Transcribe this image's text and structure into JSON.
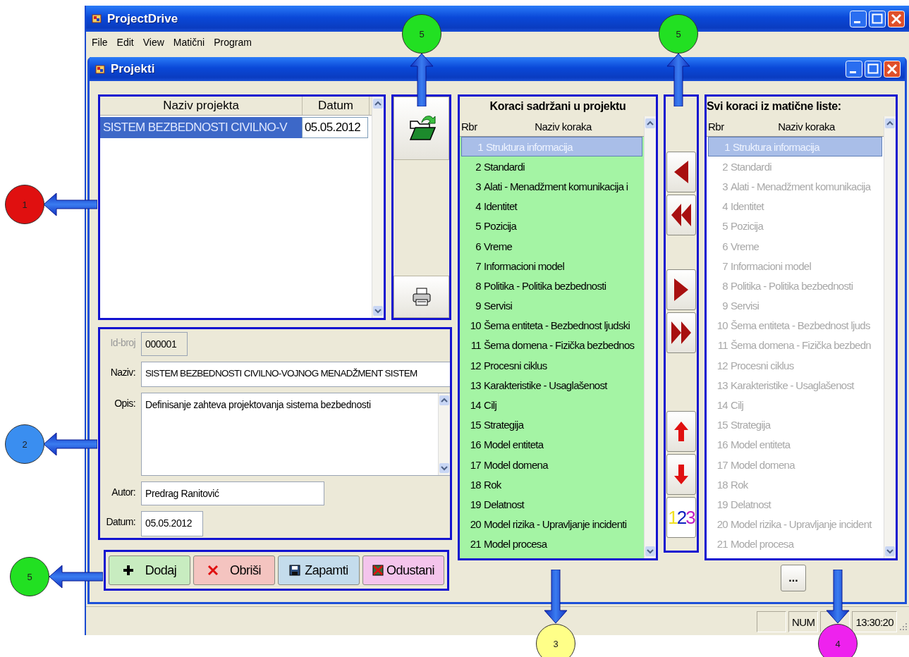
{
  "app": {
    "title": "ProjectDrive",
    "menu": [
      "File",
      "Edit",
      "View",
      "Matični",
      "Program"
    ]
  },
  "child": {
    "title": "Projekti"
  },
  "projects": {
    "columns": [
      "Naziv projekta",
      "Datum"
    ],
    "rows": [
      {
        "name": "SISTEM BEZBEDNOSTI CIVILNO-V",
        "date": "05.05.2012",
        "selected": true
      }
    ]
  },
  "form": {
    "fields": [
      {
        "label": "Id-broj",
        "value": "000001",
        "kind": "readonly"
      },
      {
        "label": "Naziv:",
        "value": "SISTEM BEZBEDNOSTI CIVILNO-VOJNOG MENADŽMENT SISTEM",
        "kind": "wide"
      },
      {
        "label": "Opis:",
        "value": "Definisanje zahteva projektovanja sistema bezbednosti",
        "kind": "memo"
      },
      {
        "label": "Autor:",
        "value": "Predrag Ranitović",
        "kind": "medium"
      },
      {
        "label": "Datum:",
        "value": "05.05.2012",
        "kind": "date"
      }
    ]
  },
  "actions": [
    {
      "label": "Dodaj",
      "kind": "add"
    },
    {
      "label": "Obriši",
      "kind": "delete"
    },
    {
      "label": "Zapamti",
      "kind": "save"
    },
    {
      "label": "Odustani",
      "kind": "cancel"
    }
  ],
  "project_steps": {
    "title": "Koraci sadržani u projektu",
    "columns": [
      "Rbr",
      "Naziv koraka"
    ],
    "disabled": false,
    "rows": [
      {
        "rbr": "1",
        "name": "Struktura informacija",
        "selected": true
      },
      {
        "rbr": "2",
        "name": "Standardi",
        "selected": false
      },
      {
        "rbr": "3",
        "name": "Alati - Menadžment komunikacija i",
        "selected": false
      },
      {
        "rbr": "4",
        "name": "Identitet",
        "selected": false
      },
      {
        "rbr": "5",
        "name": "Pozicija",
        "selected": false
      },
      {
        "rbr": "6",
        "name": "Vreme",
        "selected": false
      },
      {
        "rbr": "7",
        "name": "Informacioni model",
        "selected": false
      },
      {
        "rbr": "8",
        "name": "Politika - Politika bezbednosti",
        "selected": false
      },
      {
        "rbr": "9",
        "name": "Servisi",
        "selected": false
      },
      {
        "rbr": "10",
        "name": "Šema entiteta - Bezbednost ljudski",
        "selected": false
      },
      {
        "rbr": "11",
        "name": "Šema domena - Fizička bezbednos",
        "selected": false
      },
      {
        "rbr": "12",
        "name": "Procesni ciklus",
        "selected": false
      },
      {
        "rbr": "13",
        "name": "Karakteristike - Usaglašenost",
        "selected": false
      },
      {
        "rbr": "14",
        "name": "Cilj",
        "selected": false
      },
      {
        "rbr": "15",
        "name": "Strategija",
        "selected": false
      },
      {
        "rbr": "16",
        "name": "Model entiteta",
        "selected": false
      },
      {
        "rbr": "17",
        "name": "Model domena",
        "selected": false
      },
      {
        "rbr": "18",
        "name": "Rok",
        "selected": false
      },
      {
        "rbr": "19",
        "name": "Delatnost",
        "selected": false
      },
      {
        "rbr": "20",
        "name": "Model rizika - Upravljanje incidenti",
        "selected": false
      },
      {
        "rbr": "21",
        "name": "Model procesa",
        "selected": false
      }
    ]
  },
  "transfer_buttons": [
    {
      "kind": "left"
    },
    {
      "kind": "all-left"
    },
    {
      "kind": "right"
    },
    {
      "kind": "all-right"
    },
    {
      "kind": "up"
    },
    {
      "kind": "down"
    },
    {
      "kind": "renumber",
      "label": "123"
    }
  ],
  "master_steps": {
    "title": "Svi koraci iz matične liste:",
    "columns": [
      "Rbr",
      "Naziv koraka"
    ],
    "disabled": true,
    "rows": [
      {
        "rbr": "1",
        "name": "Struktura informacija",
        "selected": true
      },
      {
        "rbr": "2",
        "name": "Standardi",
        "selected": false
      },
      {
        "rbr": "3",
        "name": "Alati - Menadžment komunikacija",
        "selected": false
      },
      {
        "rbr": "4",
        "name": "Identitet",
        "selected": false
      },
      {
        "rbr": "5",
        "name": "Pozicija",
        "selected": false
      },
      {
        "rbr": "6",
        "name": "Vreme",
        "selected": false
      },
      {
        "rbr": "7",
        "name": "Informacioni model",
        "selected": false
      },
      {
        "rbr": "8",
        "name": "Politika - Politika bezbednosti",
        "selected": false
      },
      {
        "rbr": "9",
        "name": "Servisi",
        "selected": false
      },
      {
        "rbr": "10",
        "name": "Šema entiteta - Bezbednost ljuds",
        "selected": false
      },
      {
        "rbr": "11",
        "name": "Šema domena - Fizička bezbedn",
        "selected": false
      },
      {
        "rbr": "12",
        "name": "Procesni ciklus",
        "selected": false
      },
      {
        "rbr": "13",
        "name": "Karakteristike - Usaglašenost",
        "selected": false
      },
      {
        "rbr": "14",
        "name": "Cilj",
        "selected": false
      },
      {
        "rbr": "15",
        "name": "Strategija",
        "selected": false
      },
      {
        "rbr": "16",
        "name": "Model entiteta",
        "selected": false
      },
      {
        "rbr": "17",
        "name": "Model domena",
        "selected": false
      },
      {
        "rbr": "18",
        "name": "Rok",
        "selected": false
      },
      {
        "rbr": "19",
        "name": "Delatnost",
        "selected": false
      },
      {
        "rbr": "20",
        "name": "Model rizika - Upravljanje incident",
        "selected": false
      },
      {
        "rbr": "21",
        "name": "Model procesa",
        "selected": false
      }
    ]
  },
  "more_button": "...",
  "status_bar": {
    "panels": [
      {
        "kind": "blank"
      },
      {
        "kind": "text",
        "text": "NUM"
      },
      {
        "kind": "blank"
      },
      {
        "kind": "text",
        "text": "13:30:20"
      }
    ]
  },
  "callouts": [
    {
      "label": "1",
      "color": "#e01010"
    },
    {
      "label": "2",
      "color": "#3a8ef0"
    },
    {
      "label": "5",
      "color": "#22e022"
    },
    {
      "label": "5",
      "color": "#22e022"
    },
    {
      "label": "5",
      "color": "#22e022"
    },
    {
      "label": "3",
      "color": "#ffff88"
    },
    {
      "label": "4",
      "color": "#ee22ee"
    }
  ]
}
